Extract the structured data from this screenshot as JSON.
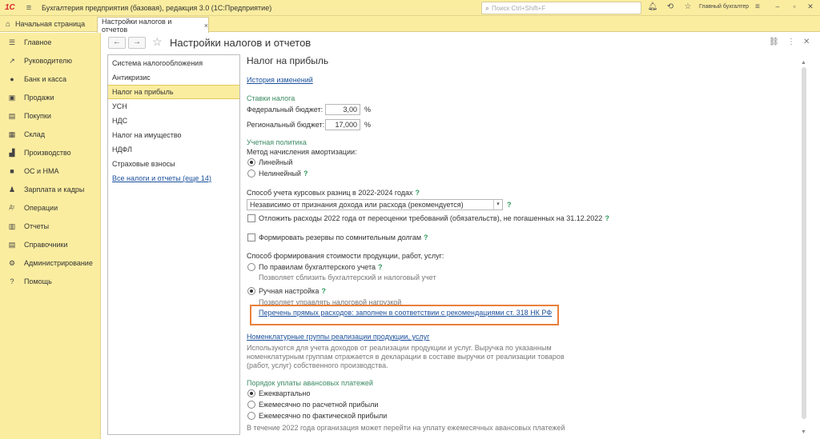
{
  "app": {
    "logo": "1С",
    "title": "Бухгалтерия предприятия (базовая), редакция 3.0  (1С:Предприятие)",
    "search_placeholder": "Поиск Ctrl+Shift+F",
    "user": "Главный бухгалтер"
  },
  "tabs": {
    "home": "Начальная страница",
    "active": "Настройки налогов и отчетов",
    "close": "×"
  },
  "sidebar": {
    "items": [
      {
        "label": "Главное",
        "icon": "menu-icon"
      },
      {
        "label": "Руководителю",
        "icon": "trend-icon"
      },
      {
        "label": "Банк и касса",
        "icon": "coin-icon"
      },
      {
        "label": "Продажи",
        "icon": "bag-icon"
      },
      {
        "label": "Покупки",
        "icon": "cart-icon"
      },
      {
        "label": "Склад",
        "icon": "warehouse-icon"
      },
      {
        "label": "Производство",
        "icon": "factory-icon"
      },
      {
        "label": "ОС и НМА",
        "icon": "truck-icon"
      },
      {
        "label": "Зарплата и кадры",
        "icon": "people-icon"
      },
      {
        "label": "Операции",
        "icon": "dt-kt-icon"
      },
      {
        "label": "Отчеты",
        "icon": "report-icon"
      },
      {
        "label": "Справочники",
        "icon": "book-icon"
      },
      {
        "label": "Администрирование",
        "icon": "gear-icon"
      },
      {
        "label": "Помощь",
        "icon": "help-icon"
      }
    ]
  },
  "page": {
    "title": "Настройки налогов и отчетов",
    "back": "←",
    "forward": "→"
  },
  "list": {
    "items": [
      {
        "label": "Система налогообложения",
        "selected": false,
        "link": false
      },
      {
        "label": "Антикризис",
        "selected": false,
        "link": false
      },
      {
        "label": "Налог на прибыль",
        "selected": true,
        "link": false
      },
      {
        "label": "УСН",
        "selected": false,
        "link": false
      },
      {
        "label": "НДС",
        "selected": false,
        "link": false
      },
      {
        "label": "Налог на имущество",
        "selected": false,
        "link": false
      },
      {
        "label": "НДФЛ",
        "selected": false,
        "link": false
      },
      {
        "label": "Страховые взносы",
        "selected": false,
        "link": false
      },
      {
        "label": "Все налоги и отчеты (еще 14)",
        "selected": false,
        "link": true
      }
    ]
  },
  "content": {
    "title": "Налог на прибыль",
    "history_link": "История изменений",
    "rates": {
      "header": "Ставки налога",
      "federal_label": "Федеральный бюджет:",
      "federal_value": "3,00",
      "regional_label": "Региональный бюджет:",
      "regional_value": "17,000",
      "percent": "%"
    },
    "policy": {
      "header": "Учетная политика",
      "amort_label": "Метод начисления амортизации:",
      "linear": "Линейный",
      "nonlinear": "Нелинейный"
    },
    "fx": {
      "label": "Способ учета курсовых разниц в 2022-2024 годах",
      "select_value": "Независимо от признания дохода или расхода (рекомендуется)",
      "postpone": "Отложить расходы 2022 года от переоценки требований (обязательств), не погашенных на 31.12.2022"
    },
    "reserves": "Формировать резервы по сомнительным долгам",
    "cost": {
      "label": "Способ формирования стоимости продукции, работ, услуг:",
      "by_rules": "По правилам бухгалтерского учета",
      "by_rules_hint": "Позволяет сблизить бухгалтерский и налоговый учет",
      "manual": "Ручная настройка",
      "manual_hint": "Позволяет управлять налоговой нагрузкой",
      "direct_link": "Перечень прямых расходов: заполнен в соответствии с рекомендациями ст. 318 НК РФ"
    },
    "nomenclature": {
      "link": "Номенклатурные группы реализации продукции, услуг",
      "hint1": "Используются для учета доходов от реализации продукции и услуг. Выручка по указанным",
      "hint2": "номенклатурным группам отражается в декларации в составе выручки от реализации товаров",
      "hint3": "(работ, услуг) собственного производства."
    },
    "advance": {
      "header": "Порядок уплаты авансовых платежей",
      "quarterly": "Ежеквартально",
      "monthly_calc": "Ежемесячно по расчетной прибыли",
      "monthly_fact": "Ежемесячно по фактической прибыли",
      "note": "В течение 2022 года организация может перейти на уплату ежемесячных авансовых платежей"
    },
    "q": "?"
  },
  "colors": {
    "yellow_bar": "#fbeda0",
    "link": "#1a4f9c",
    "section": "#3b8a62",
    "highlight_border": "#e9803a"
  }
}
